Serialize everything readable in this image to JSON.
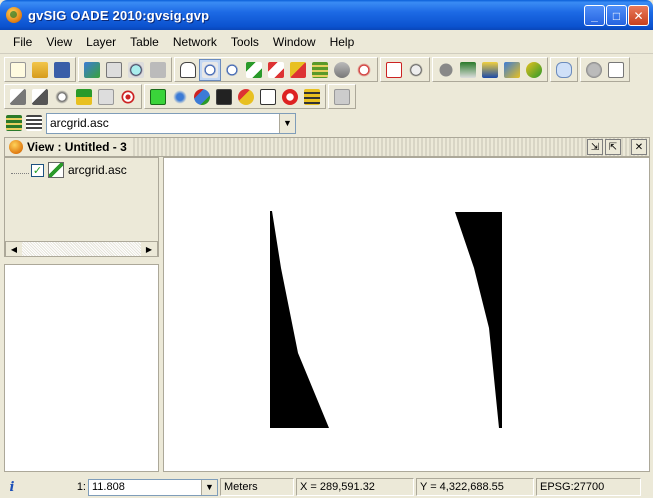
{
  "window": {
    "title": "gvSIG OADE 2010:gvsig.gvp",
    "minimize_label": "_",
    "maximize_label": "□",
    "close_label": "✕"
  },
  "menu": [
    "File",
    "View",
    "Layer",
    "Table",
    "Network",
    "Tools",
    "Window",
    "Help"
  ],
  "toolbar1_icons": [
    "new-icon",
    "open-icon",
    "save-icon",
    "add-layer-icon",
    "print-preview-icon",
    "find-icon",
    "layer-props-icon",
    "pan-icon",
    "zoom-in-icon",
    "zoom-out-icon",
    "zoom-full-icon",
    "zoom-select-icon",
    "zoom-layer-icon",
    "layers-icon",
    "locator-icon",
    "query-icon",
    "measure-icon",
    "magnify-icon",
    "info-icon",
    "coords-icon",
    "ruler-icon",
    "area-icon",
    "link-icon",
    "comments-icon",
    "circle-icon",
    "window-icon"
  ],
  "toolbar2_icons": [
    "select-icon",
    "select-point-icon",
    "select-polygon-icon",
    "attribute-icon",
    "graphic-icon",
    "target-icon",
    "select-layer-icon",
    "tree-icon",
    "network-icon",
    "console-icon",
    "rocket-icon",
    "edit-icon",
    "record-icon",
    "stack-icon",
    "unknown-icon"
  ],
  "layer_combo": {
    "value": "arcgrid.asc",
    "arrow_label": "▼"
  },
  "view": {
    "title": "View : Untitled - 3",
    "minimize_label": "⇲",
    "restore_label": "⇱",
    "close_label": "✕"
  },
  "toc": {
    "layer_name": "arcgrid.asc",
    "checked_label": "✓",
    "scroll_left": "◀",
    "scroll_right": "▶"
  },
  "map": {
    "background": "#ffffff",
    "raster_color": "#000000"
  },
  "status": {
    "info_label": "i",
    "scale_prefix": "1:",
    "scale_value": "11.808",
    "scale_arrow": "▼",
    "units": "Meters",
    "x_coord": "X = 289,591.32",
    "y_coord": "Y = 4,322,688.55",
    "crs": "EPSG:27700"
  }
}
